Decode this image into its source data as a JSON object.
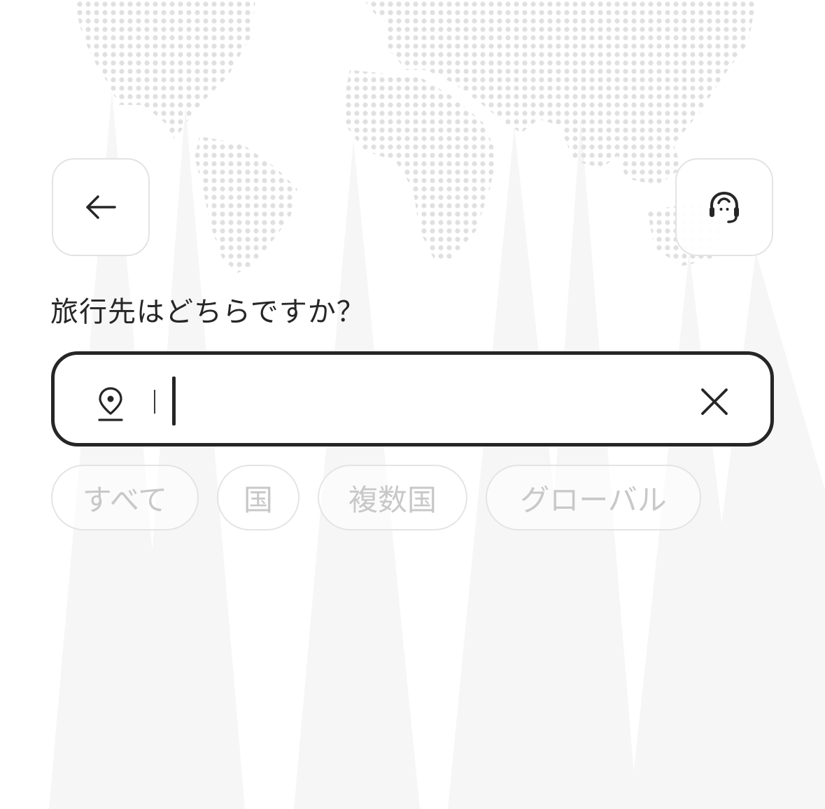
{
  "header": {
    "back_icon": "arrow-left-icon",
    "support_icon": "headset-icon"
  },
  "main": {
    "question": "旅行先はどちらですか？",
    "search": {
      "location_icon": "location-pin-icon",
      "value": "",
      "clear_icon": "close-icon"
    },
    "filters": [
      {
        "label": "すべて"
      },
      {
        "label": "国"
      },
      {
        "label": "複数国"
      },
      {
        "label": "グローバル"
      }
    ]
  },
  "colors": {
    "text": "#262626",
    "chip_text": "#c8c8c8",
    "chip_border": "#e4e4e4",
    "map_dots": "#e0e0e0"
  }
}
